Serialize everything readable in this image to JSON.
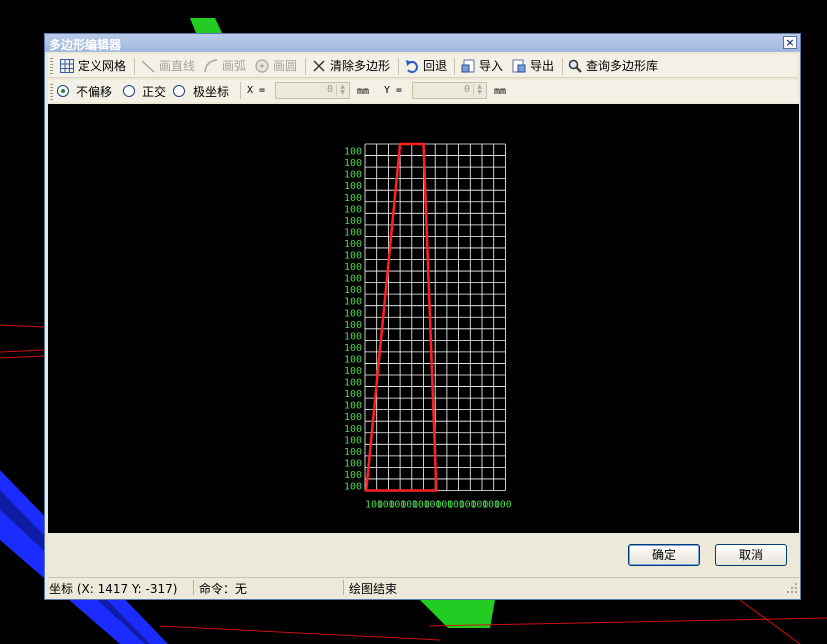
{
  "window": {
    "title": "多边形编辑器",
    "close": "×"
  },
  "toolbar": {
    "define_grid": "定义网格",
    "draw_line": "画直线",
    "draw_arc": "画弧",
    "draw_circle": "画圆",
    "clear_polygon": "清除多边形",
    "undo": "回退",
    "import": "导入",
    "export": "导出",
    "query_library": "查询多边形库"
  },
  "options": {
    "no_offset": "不偏移",
    "orthogonal": "正交",
    "polar": "极坐标",
    "x_label": "X =",
    "x_value": "0",
    "x_unit": "mm",
    "y_label": "Y =",
    "y_value": "0",
    "y_unit": "mm",
    "selected": "no_offset"
  },
  "grid": {
    "row_labels": [
      "100",
      "100",
      "100",
      "100",
      "100",
      "100",
      "100",
      "100",
      "100",
      "100",
      "100",
      "100",
      "100",
      "100",
      "100",
      "100",
      "100",
      "100",
      "100",
      "100",
      "100",
      "100",
      "100",
      "100",
      "100",
      "100",
      "100",
      "100",
      "100",
      "100"
    ],
    "col_labels": [
      "100",
      "100",
      "100",
      "100",
      "100",
      "100",
      "100",
      "100",
      "100",
      "100",
      "100",
      "100"
    ],
    "grid_color": "#ffffff",
    "label_color": "#4fd64f",
    "polygon_color": "#ff2020"
  },
  "buttons": {
    "ok": "确定",
    "cancel": "取消"
  },
  "status": {
    "coords": "坐标 (X: 1417 Y: -317)",
    "command": "命令：无",
    "message": "绘图结束"
  }
}
